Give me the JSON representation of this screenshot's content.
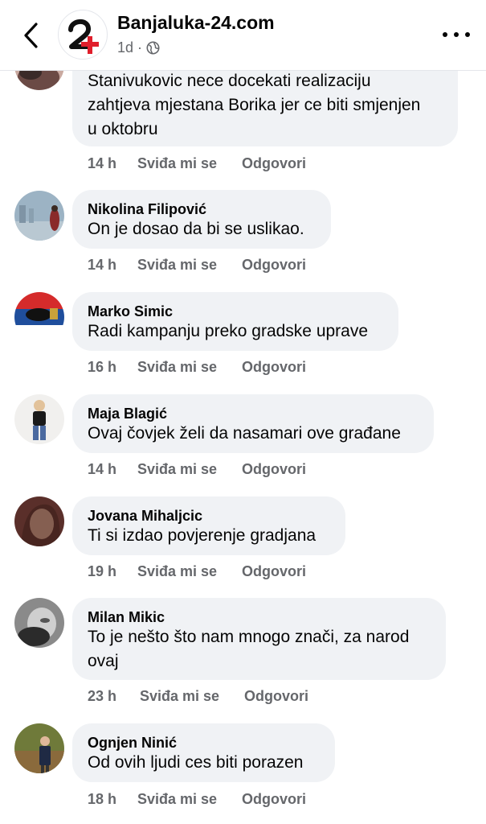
{
  "header": {
    "page_name": "Banjaluka-24.com",
    "post_age": "1d",
    "separator": "·",
    "icons": {
      "back": "chevron-left-icon",
      "audience": "globe-icon",
      "more": "more-horizontal-icon",
      "logo": "banjaluka-24-logo"
    }
  },
  "colors": {
    "bubble": "#f0f2f5",
    "meta_text": "#65676b",
    "logo_red": "#e01e2b",
    "logo_black": "#111111"
  },
  "comments": [
    {
      "author": "",
      "lines": [
        "Stanivukovic nece docekati realizaciju",
        "zahtjeva mjestana Borika jer ce biti smjenjen",
        "u oktobru"
      ],
      "time": "14 h",
      "like": "Sviđa mi se",
      "reply": "Odgovori"
    },
    {
      "author": "Nikolina Filipović",
      "lines": [
        "On je dosao da bi se uslikao."
      ],
      "time": "14 h",
      "like": "Sviđa mi se",
      "reply": "Odgovori"
    },
    {
      "author": "Marko Simic",
      "lines": [
        "Radi kampanju preko gradske uprave"
      ],
      "time": "16 h",
      "like": "Sviđa mi se",
      "reply": "Odgovori"
    },
    {
      "author": "Maja Blagić",
      "lines": [
        "Ovaj čovjek želi da nasamari ove građane"
      ],
      "time": "14 h",
      "like": "Sviđa mi se",
      "reply": "Odgovori"
    },
    {
      "author": "Jovana Mihaljcic",
      "lines": [
        "Ti si izdao povjerenje gradjana"
      ],
      "time": "19 h",
      "like": "Sviđa mi se",
      "reply": "Odgovori"
    },
    {
      "author": "Milan Mikic",
      "lines": [
        "To je nešto što nam mnogo znači, za narod",
        "ovaj"
      ],
      "time": "23 h",
      "like": "Sviđa mi se",
      "reply": "Odgovori"
    },
    {
      "author": "Ognjen Ninić",
      "lines": [
        "Od ovih ljudi ces biti porazen"
      ],
      "time": "18 h",
      "like": "Sviđa mi se",
      "reply": "Odgovori"
    }
  ]
}
